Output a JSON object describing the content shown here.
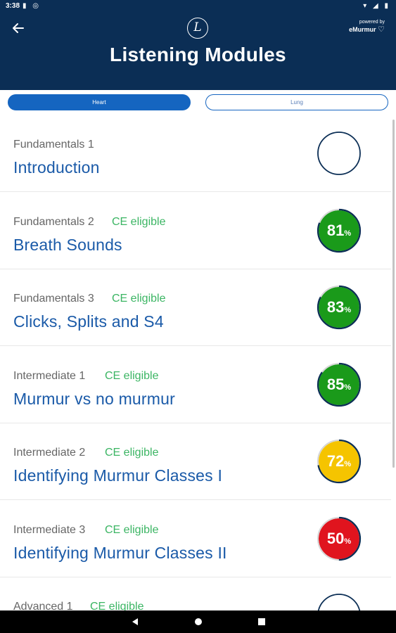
{
  "status_bar": {
    "time": "3:38",
    "left_icons": "▮ ◎",
    "right_icons": "▾ ◢ ▮"
  },
  "header": {
    "back_icon": "arrow-left-icon",
    "logo_letter": "L",
    "powered_by": "powered by",
    "brand": "eMurmur",
    "title": "Listening Modules",
    "background": "#0b2e55"
  },
  "tabs": [
    {
      "label": "Heart",
      "active": true
    },
    {
      "label": "Lung",
      "active": false
    }
  ],
  "modules": [
    {
      "level": "Fundamentals 1",
      "ce": "",
      "title": "Introduction",
      "percent": null,
      "color": "#ffffff"
    },
    {
      "level": "Fundamentals 2",
      "ce": "CE eligible",
      "title": "Breath Sounds",
      "percent": 81,
      "color": "#1a9a1a"
    },
    {
      "level": "Fundamentals 3",
      "ce": "CE eligible",
      "title": "Clicks, Splits and S4",
      "percent": 83,
      "color": "#1a9a1a"
    },
    {
      "level": "Intermediate 1",
      "ce": "CE eligible",
      "title": "Murmur vs no murmur",
      "percent": 85,
      "color": "#1a9a1a"
    },
    {
      "level": "Intermediate 2",
      "ce": "CE eligible",
      "title": "Identifying Murmur Classes I",
      "percent": 72,
      "color": "#f5c400"
    },
    {
      "level": "Intermediate 3",
      "ce": "CE eligible",
      "title": "Identifying Murmur Classes II",
      "percent": 50,
      "color": "#e0141e"
    },
    {
      "level": "Advanced 1",
      "ce": "CE eligible",
      "title": "",
      "percent": null,
      "color": "#ffffff"
    }
  ],
  "percent_symbol": "%",
  "colors": {
    "accent": "#1565c0",
    "title_text": "#1a5aa8",
    "ce_green": "#3bb563",
    "ring": "#0b2e55"
  },
  "nav": {
    "back_icon": "nav-back-icon",
    "home_icon": "nav-home-icon",
    "recents_icon": "nav-recents-icon"
  }
}
